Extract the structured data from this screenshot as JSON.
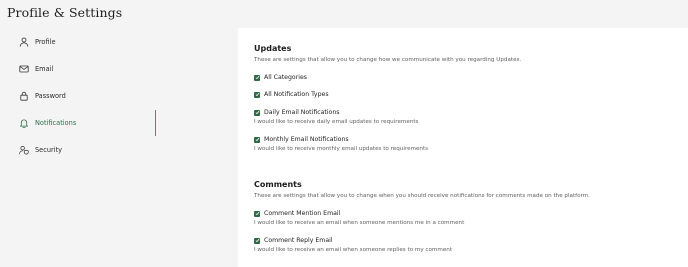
{
  "page": {
    "title": "Profile & Settings"
  },
  "sidebar": {
    "items": [
      {
        "label": "Profile",
        "icon": "user-icon",
        "active": false
      },
      {
        "label": "Email",
        "icon": "envelope-icon",
        "active": false
      },
      {
        "label": "Password",
        "icon": "lock-icon",
        "active": false
      },
      {
        "label": "Notifications",
        "icon": "bell-icon",
        "active": true
      },
      {
        "label": "Security",
        "icon": "user-shield-icon",
        "active": false
      }
    ]
  },
  "colors": {
    "accent": "#2f6a47",
    "active_text": "#2e6e4a"
  },
  "sections": {
    "updates": {
      "title": "Updates",
      "description": "These are settings that allow you to change how we communicate with you regarding Updates.",
      "options": [
        {
          "label": "All Categories",
          "checked": true,
          "description": ""
        },
        {
          "label": "All Notification Types",
          "checked": true,
          "description": ""
        },
        {
          "label": "Daily Email Notifications",
          "checked": true,
          "description": "I would like to receive daily email updates to requirements"
        },
        {
          "label": "Monthly Email Notifications",
          "checked": true,
          "description": "I would like to receive monthly email updates to requirements"
        }
      ]
    },
    "comments": {
      "title": "Comments",
      "description": "These are settings that allow you to change when you should receive notifications for comments made on the platform.",
      "options": [
        {
          "label": "Comment Mention Email",
          "checked": true,
          "description": "I would like to receive an email when someone mentions me in a comment"
        },
        {
          "label": "Comment Reply Email",
          "checked": true,
          "description": "I would like to receive an email when someone replies to my comment"
        }
      ]
    }
  }
}
